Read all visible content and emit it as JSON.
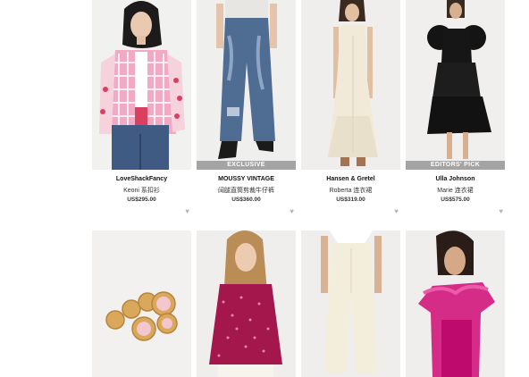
{
  "products": [
    {
      "brand": "LoveShackFancy",
      "name": "Keoni 系扣衫",
      "price": "US$295.00",
      "tag": "",
      "heart_icon": "heart-icon"
    },
    {
      "brand": "MOUSSY VINTAGE",
      "name": "阔腿直筒剪裁牛仔裤",
      "price": "US$360.00",
      "tag": "EXCLUSIVE",
      "heart_icon": "heart-icon"
    },
    {
      "brand": "Hansen & Gretel",
      "name": "Roberta 连衣裙",
      "price": "US$319.00",
      "tag": "",
      "heart_icon": "heart-icon"
    },
    {
      "brand": "Ulla Johnson",
      "name": "Marie 连衣裙",
      "price": "US$575.00",
      "tag": "EDITORS' PICK",
      "heart_icon": "heart-icon"
    },
    {
      "brand": "",
      "name": "",
      "price": "",
      "tag": "",
      "heart_icon": ""
    },
    {
      "brand": "",
      "name": "",
      "price": "",
      "tag": "",
      "heart_icon": ""
    },
    {
      "brand": "",
      "name": "",
      "price": "",
      "tag": "",
      "heart_icon": ""
    },
    {
      "brand": "",
      "name": "",
      "price": "",
      "tag": "",
      "heart_icon": ""
    }
  ],
  "colors": {
    "tag_bg": "#9a9a9a",
    "heart": "#b5b5b5",
    "image_bg": "#f3f3f3"
  }
}
